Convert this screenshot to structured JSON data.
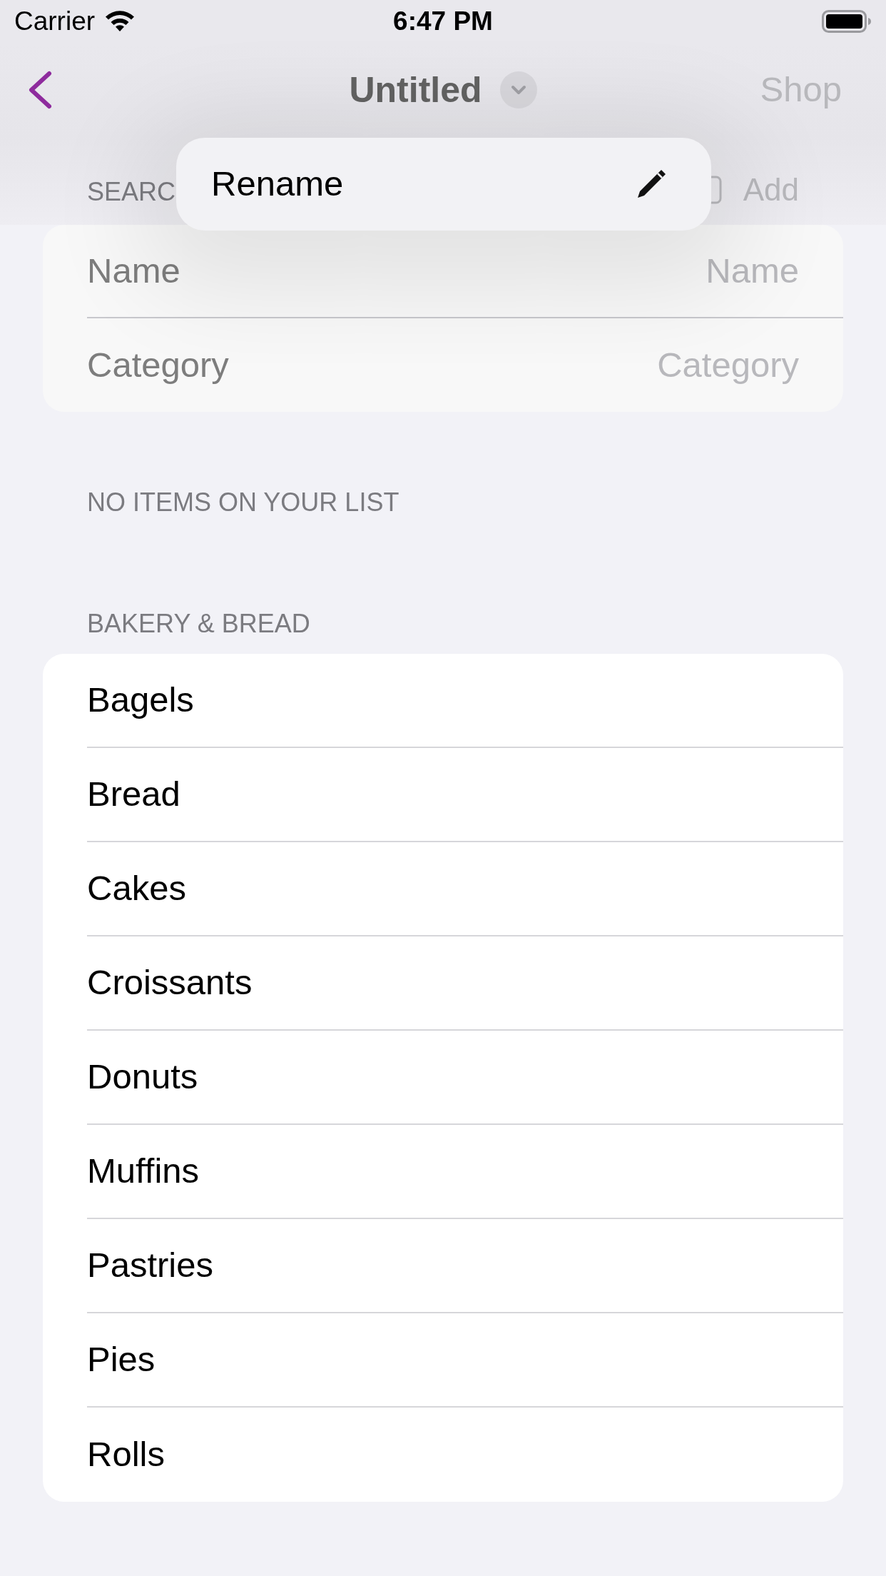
{
  "status_bar": {
    "carrier": "Carrier",
    "time": "6:47 PM"
  },
  "nav_bar": {
    "title": "Untitled",
    "action": {
      "label": "Shop",
      "disabled": true
    }
  },
  "menu": {
    "items": [
      {
        "label": "Rename"
      }
    ]
  },
  "search_section": {
    "header": "SEARC",
    "add": {
      "label": "Add",
      "disabled": true
    },
    "fields": [
      {
        "label": "Name",
        "placeholder": "Name"
      },
      {
        "label": "Category",
        "placeholder": "Category"
      }
    ]
  },
  "list_status": "NO ITEMS ON YOUR LIST",
  "sections": [
    {
      "header": "BAKERY & BREAD",
      "items": [
        "Bagels",
        "Bread",
        "Cakes",
        "Croissants",
        "Donuts",
        "Muffins",
        "Pastries",
        "Pies",
        "Rolls"
      ]
    }
  ]
}
